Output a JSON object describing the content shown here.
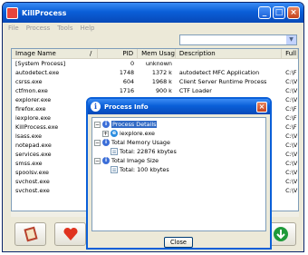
{
  "window": {
    "title": "KillProcess"
  },
  "menu": [
    "File",
    "Process",
    "Tools",
    "Help"
  ],
  "columns": {
    "name": "Image Name",
    "sort": "/",
    "pid": "PID",
    "mem": "Mem Usage",
    "desc": "Description",
    "full": "Full"
  },
  "rows": [
    {
      "name": "[System Process]",
      "pid": "0",
      "mem": "unknown",
      "desc": "",
      "full": ""
    },
    {
      "name": "autodetect.exe",
      "pid": "1748",
      "mem": "1372 k",
      "desc": "autodetect MFC Application",
      "full": "C:\\F"
    },
    {
      "name": "csrss.exe",
      "pid": "604",
      "mem": "1968 k",
      "desc": "Client Server Runtime Process",
      "full": "C:\\V"
    },
    {
      "name": "ctfmon.exe",
      "pid": "1716",
      "mem": "900 k",
      "desc": "CTF Loader",
      "full": "C:\\V"
    },
    {
      "name": "explorer.exe",
      "pid": "",
      "mem": "",
      "desc": "",
      "full": "C:\\V"
    },
    {
      "name": "firefox.exe",
      "pid": "",
      "mem": "",
      "desc": "",
      "full": "C:\\F"
    },
    {
      "name": "iexplore.exe",
      "pid": "",
      "mem": "",
      "desc": "",
      "full": "C:\\F"
    },
    {
      "name": "KillProcess.exe",
      "pid": "",
      "mem": "",
      "desc": "",
      "full": "C:\\F"
    },
    {
      "name": "lsass.exe",
      "pid": "",
      "mem": "",
      "desc": "",
      "full": "C:\\V"
    },
    {
      "name": "notepad.exe",
      "pid": "",
      "mem": "",
      "desc": "",
      "full": "C:\\V"
    },
    {
      "name": "services.exe",
      "pid": "",
      "mem": "",
      "desc": "",
      "full": "C:\\V"
    },
    {
      "name": "smss.exe",
      "pid": "",
      "mem": "",
      "desc": "",
      "full": "C:\\V"
    },
    {
      "name": "spoolsv.exe",
      "pid": "",
      "mem": "",
      "desc": "",
      "full": "C:\\V"
    },
    {
      "name": "svchost.exe",
      "pid": "",
      "mem": "",
      "desc": "",
      "full": "C:\\V"
    },
    {
      "name": "svchost.exe",
      "pid": "",
      "mem": "",
      "desc": "",
      "full": "C:\\V"
    }
  ],
  "dialog": {
    "title": "Process Info",
    "details": "Process Details",
    "process": "iexplore.exe",
    "memory": "Total Memory Usage",
    "memory_value": "Total: 22876 kbytes",
    "image": "Total Image Size",
    "image_value": "Total: 100 kbytes",
    "close": "Close"
  },
  "colors": {
    "titlebar": "#0a5fd8",
    "selection": "#316ac5"
  }
}
